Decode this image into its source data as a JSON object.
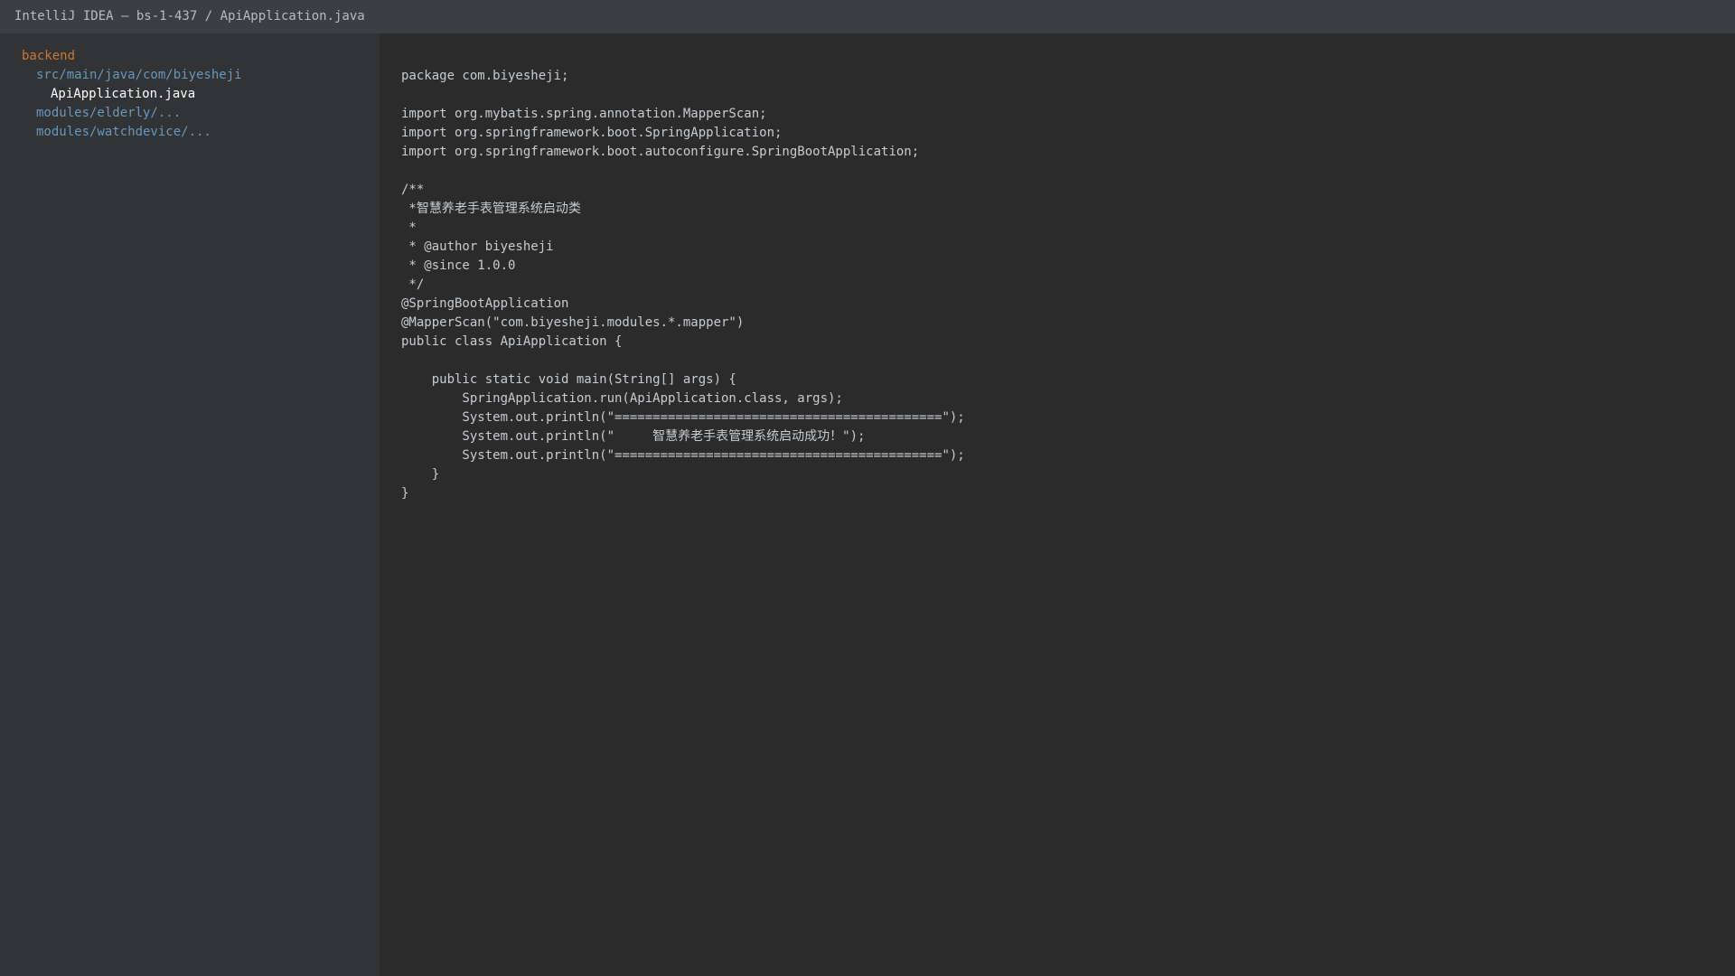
{
  "window": {
    "title": "IntelliJ IDEA — bs-1-437 / ApiApplication.java"
  },
  "colors": {
    "titlebar_bg": "#3c3f41",
    "sidebar_bg": "#313335",
    "editor_bg": "#2b2b2b",
    "folder_root": "#cc7832",
    "folder_path": "#6897bb",
    "file_selected": "#ffffff",
    "code_text": "#c7ccd1"
  },
  "project_tree": {
    "items": [
      {
        "label": "backend",
        "level": 0,
        "kind": "root"
      },
      {
        "label": "src/main/java/com/biyesheji",
        "level": 1,
        "kind": "path"
      },
      {
        "label": "ApiApplication.java",
        "level": 2,
        "kind": "file-selected"
      },
      {
        "label": "modules/elderly/...",
        "level": 1,
        "kind": "path"
      },
      {
        "label": "modules/watchdevice/...",
        "level": 1,
        "kind": "path"
      }
    ]
  },
  "editor": {
    "file_name": "ApiApplication.java",
    "lines": [
      "package com.biyesheji;",
      "",
      "import org.mybatis.spring.annotation.MapperScan;",
      "import org.springframework.boot.SpringApplication;",
      "import org.springframework.boot.autoconfigure.SpringBootApplication;",
      "",
      "/**",
      " *智慧养老手表管理系统启动类",
      " *",
      " * @author biyesheji",
      " * @since 1.0.0",
      " */",
      "@SpringBootApplication",
      "@MapperScan(\"com.biyesheji.modules.*.mapper\")",
      "public class ApiApplication {",
      "",
      "    public static void main(String[] args) {",
      "        SpringApplication.run(ApiApplication.class, args);",
      "        System.out.println(\"===========================================\");",
      "        System.out.println(\"     智慧养老手表管理系统启动成功！\");",
      "        System.out.println(\"===========================================\");",
      "    }",
      "}"
    ]
  }
}
